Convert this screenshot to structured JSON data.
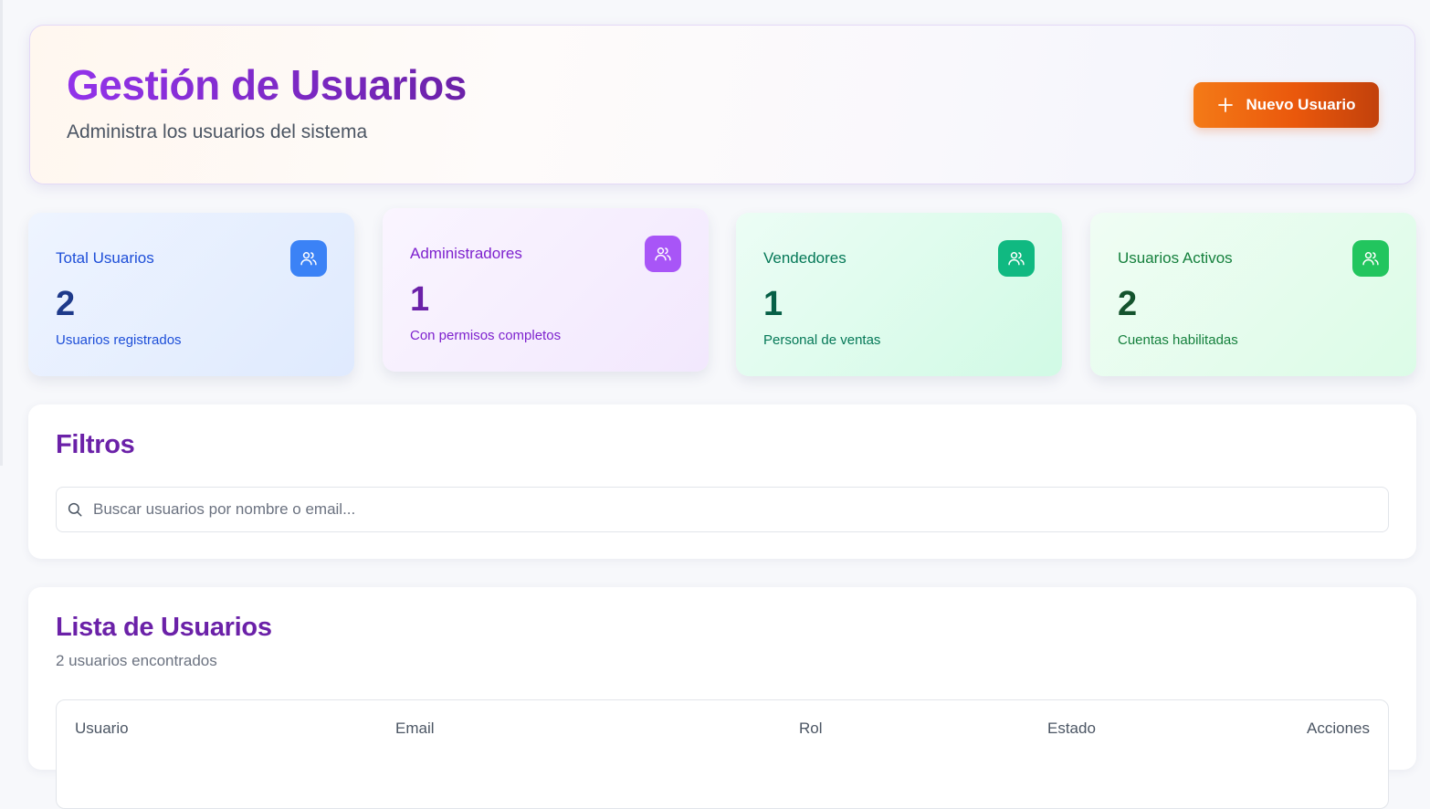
{
  "header": {
    "title": "Gestión de Usuarios",
    "subtitle": "Administra los usuarios del sistema",
    "new_user_label": "Nuevo Usuario"
  },
  "stats": [
    {
      "title": "Total Usuarios",
      "value": "2",
      "caption": "Usuarios registrados",
      "icon": "users-icon",
      "color": "#3b82f6"
    },
    {
      "title": "Administradores",
      "value": "1",
      "caption": "Con permisos completos",
      "icon": "users-icon",
      "color": "#a855f7"
    },
    {
      "title": "Vendedores",
      "value": "1",
      "caption": "Personal de ventas",
      "icon": "users-icon",
      "color": "#10b981"
    },
    {
      "title": "Usuarios Activos",
      "value": "2",
      "caption": "Cuentas habilitadas",
      "icon": "users-icon",
      "color": "#22c55e"
    }
  ],
  "filters": {
    "title": "Filtros",
    "search_placeholder": "Buscar usuarios por nombre o email...",
    "search_value": ""
  },
  "list": {
    "title": "Lista de Usuarios",
    "count_text": "2 usuarios encontrados",
    "columns": [
      "Usuario",
      "Email",
      "Rol",
      "Estado",
      "Acciones"
    ]
  },
  "colors": {
    "accent_purple": "#7e22ce",
    "accent_orange": "#ea580c"
  }
}
